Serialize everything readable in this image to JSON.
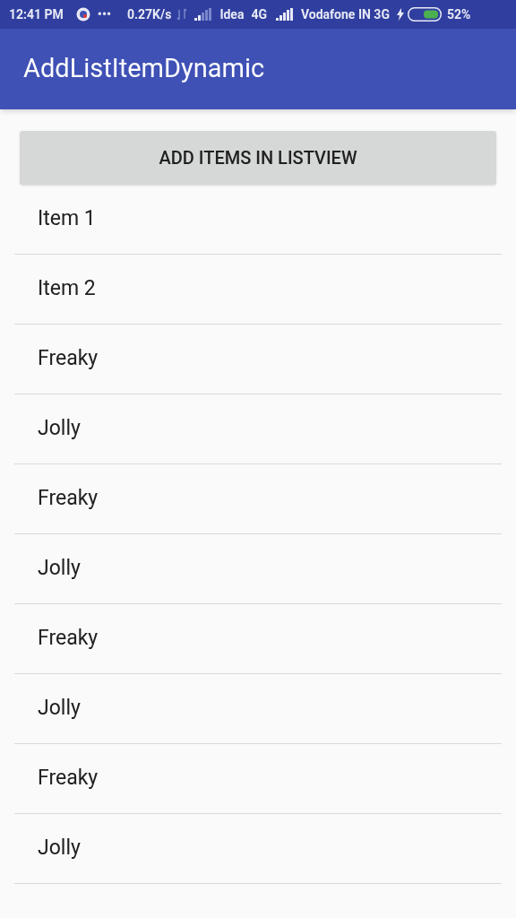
{
  "status_bar": {
    "time": "12:41 PM",
    "dots": "•••",
    "speed": "0.27K/s",
    "carrier_1": "Idea",
    "network_1": "4G",
    "carrier_2": "Vodafone IN 3G",
    "battery": "52%"
  },
  "app_bar": {
    "title": "AddListItemDynamic"
  },
  "add_button": {
    "label": "ADD ITEMS IN LISTVIEW"
  },
  "items": [
    {
      "label": "Item 1"
    },
    {
      "label": "Item 2"
    },
    {
      "label": "Freaky"
    },
    {
      "label": "Jolly"
    },
    {
      "label": "Freaky"
    },
    {
      "label": "Jolly"
    },
    {
      "label": "Freaky"
    },
    {
      "label": "Jolly"
    },
    {
      "label": "Freaky"
    },
    {
      "label": "Jolly"
    }
  ]
}
